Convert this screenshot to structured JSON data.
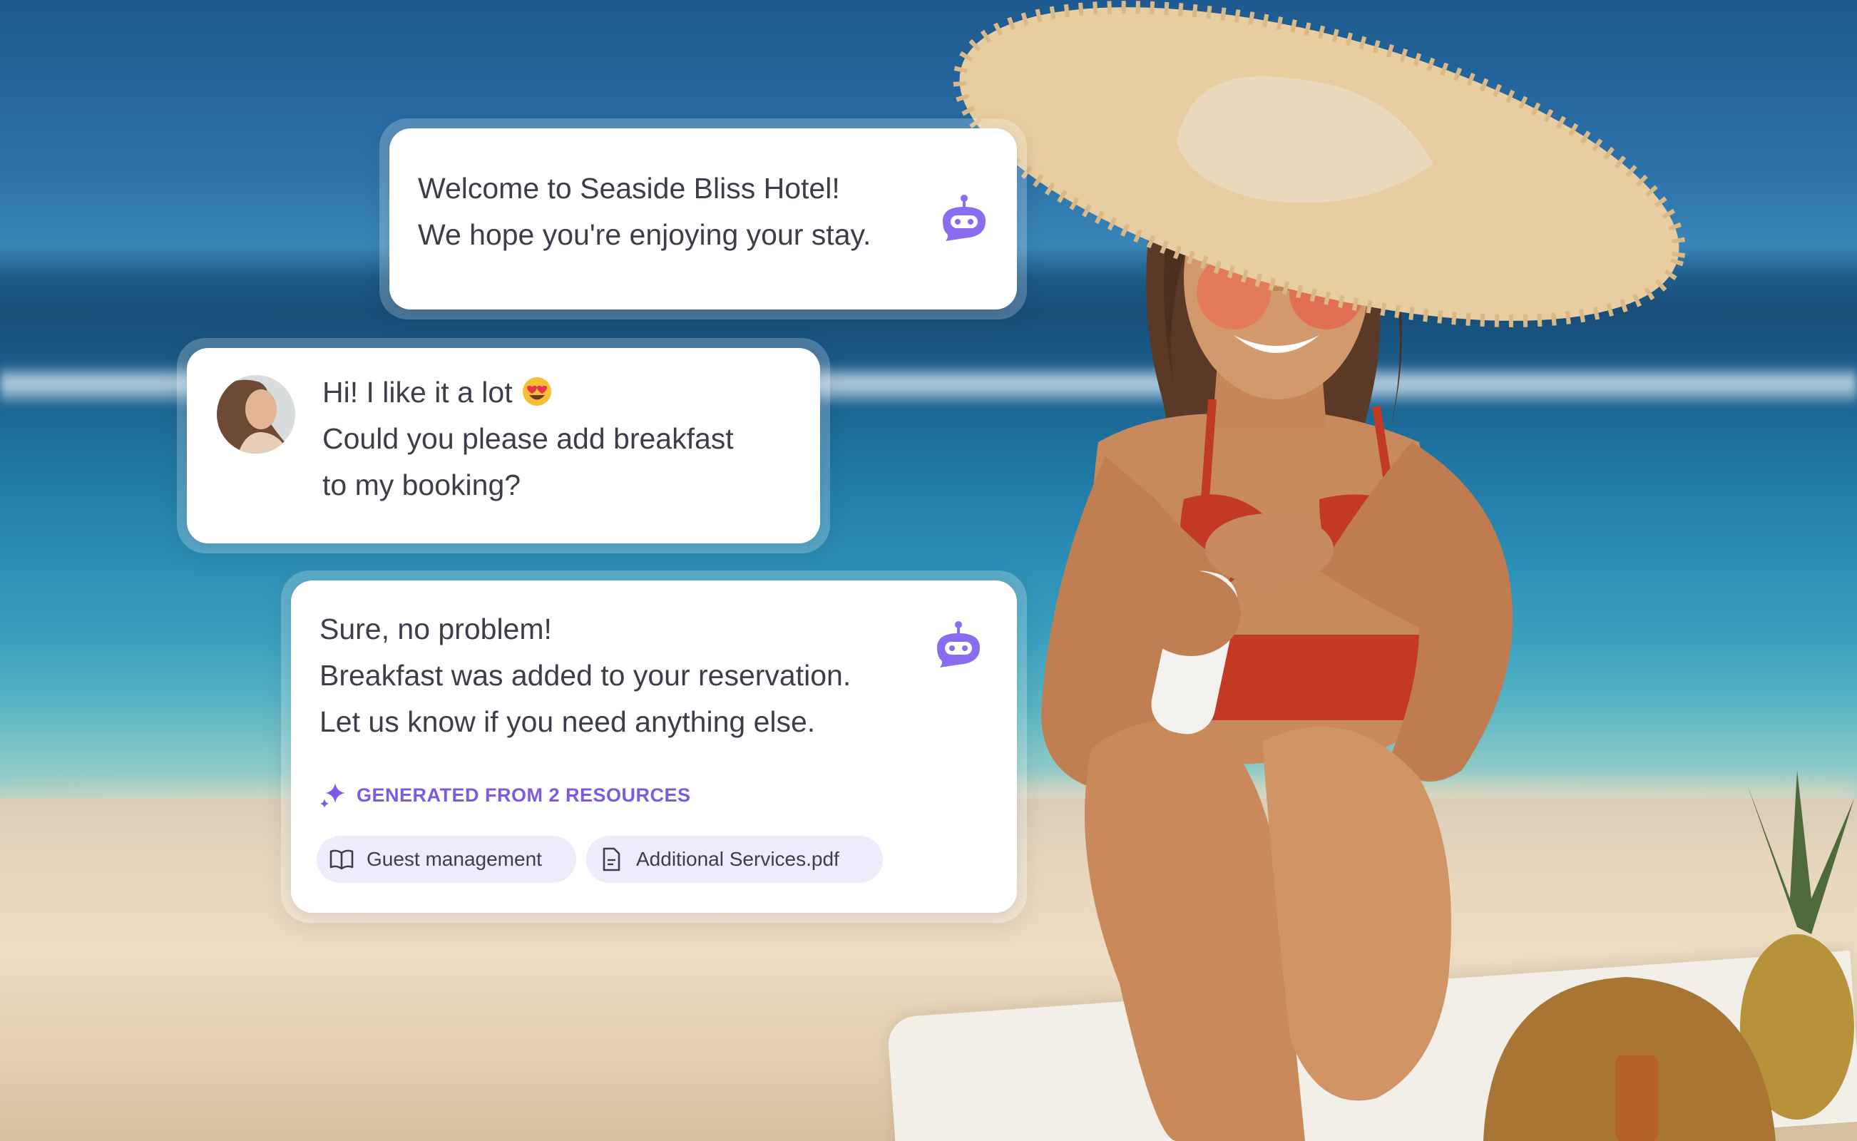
{
  "hotel_name": "Seaside Bliss Hotel",
  "messages": {
    "welcome": {
      "sender": "bot",
      "lines": [
        "Welcome to Seaside Bliss Hotel!",
        "We hope you're enjoying your stay."
      ]
    },
    "guest": {
      "sender": "guest",
      "lines": [
        "Hi! I like it a lot",
        "Could you please add breakfast",
        "to my booking?"
      ],
      "emoji": "heart-eyes-emoji"
    },
    "reply": {
      "sender": "bot",
      "lines": [
        "Sure, no problem!",
        "Breakfast was added to your reservation.",
        "Let us know if you need anything else."
      ],
      "sources_label": "GENERATED FROM 2 RESOURCES",
      "sources": [
        {
          "label": "Guest management",
          "icon": "book-icon"
        },
        {
          "label": "Additional Services.pdf",
          "icon": "document-icon"
        }
      ]
    }
  },
  "colors": {
    "accent": "#7d5ae0",
    "bot_icon": "#8b6cf0",
    "chip_background": "#efebfb",
    "text": "#3c3f4a"
  }
}
